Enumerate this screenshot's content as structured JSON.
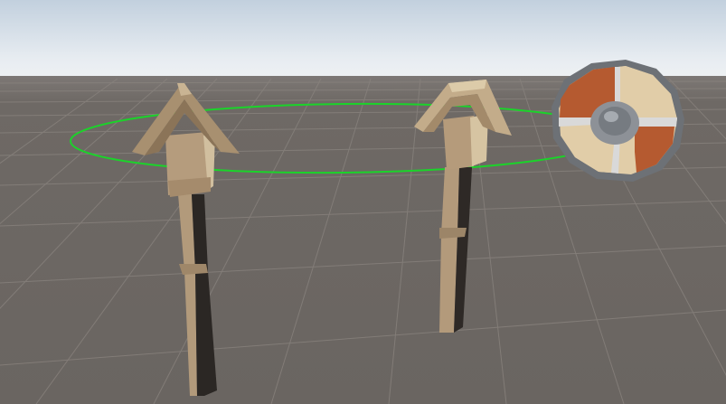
{
  "scene": {
    "colors": {
      "sky_top": "#c4d2df",
      "sky_horizon": "#eef2f5",
      "ground": "#6b6662",
      "grid_line": "#857f7b",
      "selection_ring": "#1bd32a",
      "wood_light": "#b49b7c",
      "wood_mid": "#9c8468",
      "wood_dark": "#2d2825",
      "shield_red": "#b45b32",
      "shield_tan": "#e0cda7",
      "shield_rim": "#6e7277",
      "shield_boss": "#8d9197"
    },
    "objects": [
      {
        "name": "totem-post-left",
        "icon": "wooden-post-icon"
      },
      {
        "name": "totem-post-right",
        "icon": "wooden-post-icon"
      },
      {
        "name": "round-shield",
        "icon": "shield-icon"
      },
      {
        "name": "selection-circle",
        "icon": "ring-gizmo-icon"
      }
    ]
  }
}
